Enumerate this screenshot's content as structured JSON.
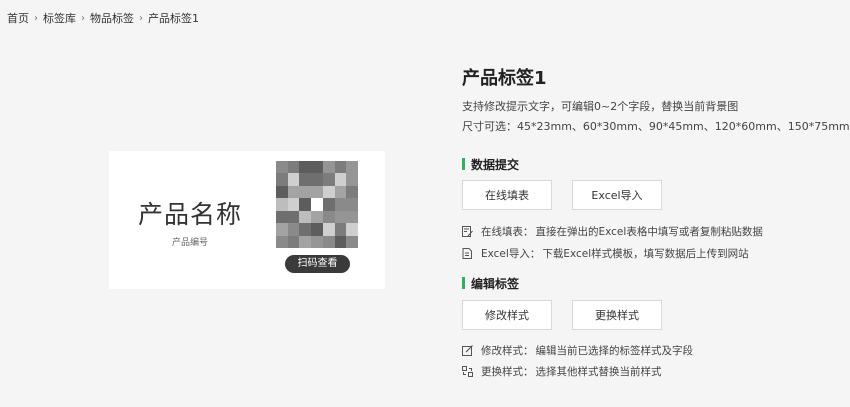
{
  "breadcrumb": {
    "items": [
      "首页",
      "标签库",
      "物品标签"
    ],
    "current": "产品标签1"
  },
  "preview": {
    "product_name": "产品名称",
    "product_code": "产品编号",
    "scan_button": "扫码查看"
  },
  "header": {
    "title": "产品标签1",
    "desc1": "支持修改提示文字，可编辑0~2个字段，替换当前背景图",
    "desc2": "尺寸可选：45*23mm、60*30mm、90*45mm、120*60mm、150*75mm"
  },
  "data_submit": {
    "title": "数据提交",
    "online_button": "在线填表",
    "excel_button": "Excel导入",
    "online_note_label": "在线填表：",
    "online_note_text": "直接在弹出的Excel表格中填写或者复制粘贴数据",
    "excel_note_label": "Excel导入：",
    "excel_note_text": "下载Excel样式模板，填写数据后上传到网站"
  },
  "edit_label": {
    "title": "编辑标签",
    "modify_button": "修改样式",
    "replace_button": "更换样式",
    "modify_note_label": "修改样式：",
    "modify_note_text": "编辑当前已选择的标签样式及字段",
    "replace_note_label": "更换样式：",
    "replace_note_text": "选择其他样式替换当前样式"
  },
  "colors": {
    "accent": "#2db163",
    "dark_button": "#3a3a3a"
  },
  "icons": {
    "breadcrumb_sep": "chevron-right-icon",
    "online_note": "edit-table-icon",
    "excel_note": "excel-doc-icon",
    "modify_note": "pencil-square-icon",
    "replace_note": "swap-icon"
  }
}
